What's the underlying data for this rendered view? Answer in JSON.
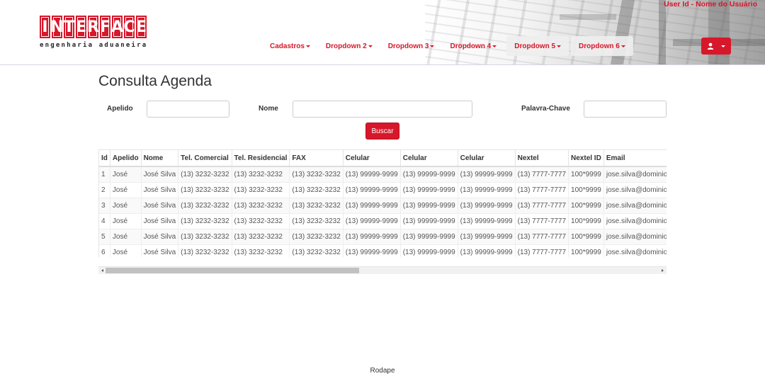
{
  "header": {
    "logo_letters": [
      "I",
      "N",
      "T",
      "E",
      "R",
      "F",
      "A",
      "C",
      "E"
    ],
    "logo_sub": "engenharia aduaneira",
    "user_id": "User Id - Nome do Usuário",
    "nav": [
      "Cadastros",
      "Dropdown 2",
      "Dropdown 3",
      "Dropdown 4",
      "Dropdown 5",
      "Dropdown 6"
    ],
    "user_icon": "user-icon"
  },
  "page": {
    "title": "Consulta Agenda",
    "labels": {
      "apelido": "Apelido",
      "nome": "Nome",
      "palavra_chave": "Palavra-Chave"
    },
    "values": {
      "apelido": "",
      "nome": "",
      "palavra_chave": ""
    },
    "search_label": "Buscar"
  },
  "table": {
    "headers": [
      "Id",
      "Apelido",
      "Nome",
      "Tel. Comercial",
      "Tel. Residencial",
      "FAX",
      "Celular",
      "Celular",
      "Celular",
      "Nextel",
      "Nextel ID",
      "Email"
    ],
    "rows": [
      [
        "1",
        "José",
        "José Silva",
        "(13) 3232-3232",
        "(13) 3232-3232",
        "(13) 3232-3232",
        "(13) 99999-9999",
        "(13) 99999-9999",
        "(13) 99999-9999",
        "(13) 7777-7777",
        "100*9999",
        "jose.silva@dominio.com.br"
      ],
      [
        "2",
        "José",
        "José Silva",
        "(13) 3232-3232",
        "(13) 3232-3232",
        "(13) 3232-3232",
        "(13) 99999-9999",
        "(13) 99999-9999",
        "(13) 99999-9999",
        "(13) 7777-7777",
        "100*9999",
        "jose.silva@dominio.com.br"
      ],
      [
        "3",
        "José",
        "José Silva",
        "(13) 3232-3232",
        "(13) 3232-3232",
        "(13) 3232-3232",
        "(13) 99999-9999",
        "(13) 99999-9999",
        "(13) 99999-9999",
        "(13) 7777-7777",
        "100*9999",
        "jose.silva@dominio.com.br"
      ],
      [
        "4",
        "José",
        "José Silva",
        "(13) 3232-3232",
        "(13) 3232-3232",
        "(13) 3232-3232",
        "(13) 99999-9999",
        "(13) 99999-9999",
        "(13) 99999-9999",
        "(13) 7777-7777",
        "100*9999",
        "jose.silva@dominio.com.br"
      ],
      [
        "5",
        "José",
        "José Silva",
        "(13) 3232-3232",
        "(13) 3232-3232",
        "(13) 3232-3232",
        "(13) 99999-9999",
        "(13) 99999-9999",
        "(13) 99999-9999",
        "(13) 7777-7777",
        "100*9999",
        "jose.silva@dominio.com.br"
      ],
      [
        "6",
        "José",
        "José Silva",
        "(13) 3232-3232",
        "(13) 3232-3232",
        "(13) 3232-3232",
        "(13) 99999-9999",
        "(13) 99999-9999",
        "(13) 99999-9999",
        "(13) 7777-7777",
        "100*9999",
        "jose.silva@dominio.com.br"
      ]
    ]
  },
  "footer": {
    "text": "Rodape"
  },
  "colors": {
    "accent": "#d7172a"
  }
}
